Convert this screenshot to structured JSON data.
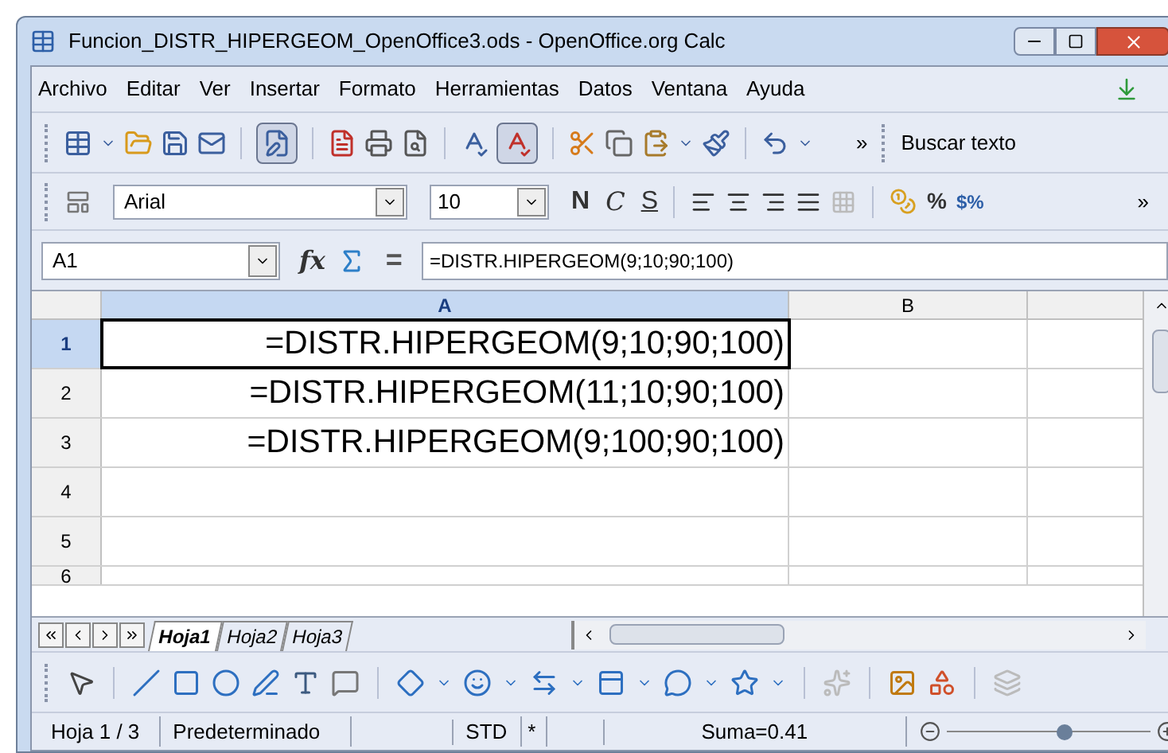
{
  "window": {
    "title": "Funcion_DISTR_HIPERGEOM_OpenOffice3.ods - OpenOffice.org Calc"
  },
  "menu": [
    {
      "label": "Archivo"
    },
    {
      "label": "Editar"
    },
    {
      "label": "Ver"
    },
    {
      "label": "Insertar"
    },
    {
      "label": "Formato"
    },
    {
      "label": "Herramientas"
    },
    {
      "label": "Datos"
    },
    {
      "label": "Ventana"
    },
    {
      "label": "Ayuda"
    }
  ],
  "standard_toolbar": {
    "edit_file_on": true,
    "auto_spellcheck_on": true,
    "overflow": "»",
    "find_placeholder": "Buscar texto"
  },
  "formatting_toolbar": {
    "font": "Arial",
    "size": "10",
    "bold": "N",
    "italic": "C",
    "underline": "S",
    "percent": "%",
    "currency": "$%",
    "overflow": "»"
  },
  "formula_bar": {
    "cell": "A1",
    "wizard": "fx",
    "equals": "=",
    "formula": "=DISTR.HIPERGEOM(9;10;90;100)"
  },
  "columns": [
    {
      "label": "A",
      "selected": true
    },
    {
      "label": "B",
      "selected": false
    }
  ],
  "rows": [
    {
      "label": "1",
      "selected": true,
      "cells": [
        "=DISTR.HIPERGEOM(9;10;90;100)",
        ""
      ]
    },
    {
      "label": "2",
      "selected": false,
      "cells": [
        "=DISTR.HIPERGEOM(11;10;90;100)",
        ""
      ]
    },
    {
      "label": "3",
      "selected": false,
      "cells": [
        "=DISTR.HIPERGEOM(9;100;90;100)",
        ""
      ]
    },
    {
      "label": "4",
      "selected": false,
      "cells": [
        "",
        ""
      ]
    },
    {
      "label": "5",
      "selected": false,
      "cells": [
        "",
        ""
      ]
    },
    {
      "label": "6",
      "selected": false,
      "cells": [
        "",
        ""
      ]
    }
  ],
  "sheet_tabs": [
    {
      "label": "Hoja1",
      "selected": true
    },
    {
      "label": "Hoja2",
      "selected": false
    },
    {
      "label": "Hoja3",
      "selected": false
    }
  ],
  "status_bar": {
    "sheet": "Hoja 1 / 3",
    "style": "Predeterminado",
    "mode": "STD",
    "modified": "*",
    "sum": "Suma=0.41",
    "zoom": {
      "level": 0.58
    }
  }
}
